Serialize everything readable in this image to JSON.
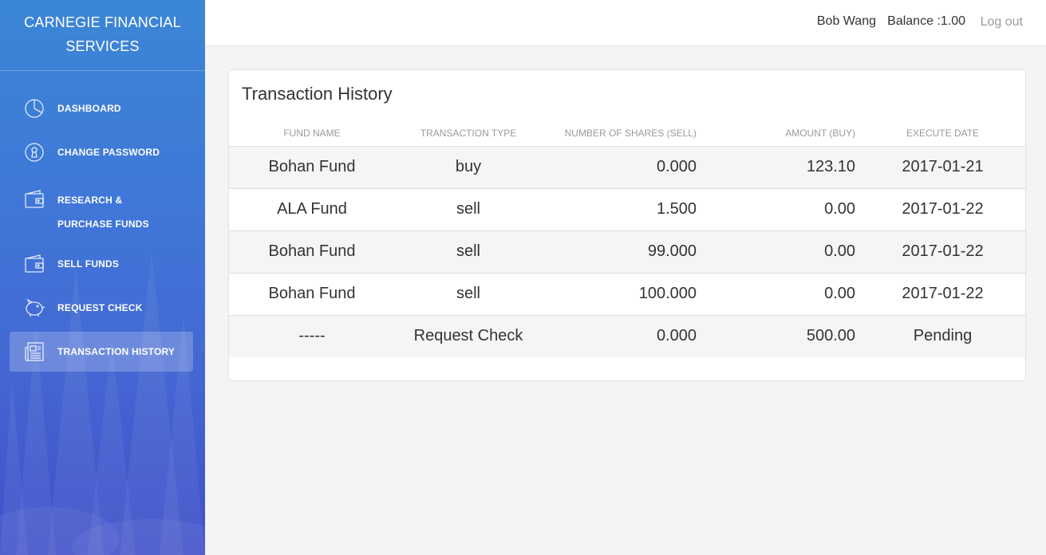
{
  "brand": {
    "line1": "CARNEGIE FINANCIAL",
    "line2": "SERVICES"
  },
  "nav": [
    {
      "label": "DASHBOARD",
      "icon": "pie-chart-icon"
    },
    {
      "label": "CHANGE PASSWORD",
      "icon": "keyhole-icon"
    },
    {
      "label": "RESEARCH & PURCHASE FUNDS",
      "icon": "wallet-icon"
    },
    {
      "label": "SELL FUNDS",
      "icon": "wallet-icon"
    },
    {
      "label": "REQUEST CHECK",
      "icon": "piggy-bank-icon"
    },
    {
      "label": "TRANSACTION HISTORY",
      "icon": "newspaper-icon",
      "active": true
    }
  ],
  "header": {
    "user": "Bob Wang",
    "balance": "Balance :1.00",
    "logout": "Log out"
  },
  "card": {
    "title": "Transaction History"
  },
  "table": {
    "columns": [
      "FUND NAME",
      "TRANSACTION TYPE",
      "NUMBER OF SHARES (SELL)",
      "AMOUNT (BUY)",
      "EXECUTE DATE"
    ],
    "rows": [
      [
        "Bohan Fund",
        "buy",
        "0.000",
        "123.10",
        "2017-01-21"
      ],
      [
        "ALA Fund",
        "sell",
        "1.500",
        "0.00",
        "2017-01-22"
      ],
      [
        "Bohan Fund",
        "sell",
        "99.000",
        "0.00",
        "2017-01-22"
      ],
      [
        "Bohan Fund",
        "sell",
        "100.000",
        "0.00",
        "2017-01-22"
      ],
      [
        "-----",
        "Request Check",
        "0.000",
        "500.00",
        "Pending"
      ]
    ]
  }
}
